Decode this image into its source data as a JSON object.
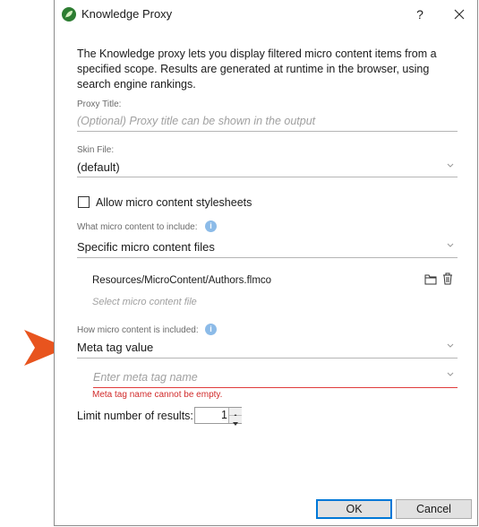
{
  "window": {
    "title": "Knowledge Proxy",
    "help_glyph": "?",
    "app_icon": "leaf-icon",
    "close_icon": "close-icon"
  },
  "description": "The Knowledge proxy lets you display filtered micro content items from a specified scope. Results are generated at runtime in the browser, using search engine rankings.",
  "proxy_title": {
    "label": "Proxy Title:",
    "placeholder": "(Optional) Proxy title can be shown in the output",
    "value": ""
  },
  "skin_file": {
    "label": "Skin File:",
    "value": "(default)"
  },
  "allow_stylesheets": {
    "label": "Allow micro content stylesheets",
    "checked": false
  },
  "content_include": {
    "label": "What micro content to include:",
    "value": "Specific micro content files"
  },
  "file_list": {
    "items": [
      "Resources/MicroContent/Authors.flmco"
    ],
    "placeholder": "Select micro content file"
  },
  "how_included": {
    "label": "How micro content is included:",
    "value": "Meta tag value"
  },
  "meta_tag": {
    "placeholder": "Enter meta tag name",
    "error": "Meta tag name cannot be empty."
  },
  "limit": {
    "label": "Limit number of results:",
    "value": "1"
  },
  "buttons": {
    "ok": "OK",
    "cancel": "Cancel"
  },
  "colors": {
    "error": "#e03c3c",
    "info": "#8cbbe8",
    "callout_arrow": "#e8541e",
    "ok_border": "#0078d7"
  }
}
